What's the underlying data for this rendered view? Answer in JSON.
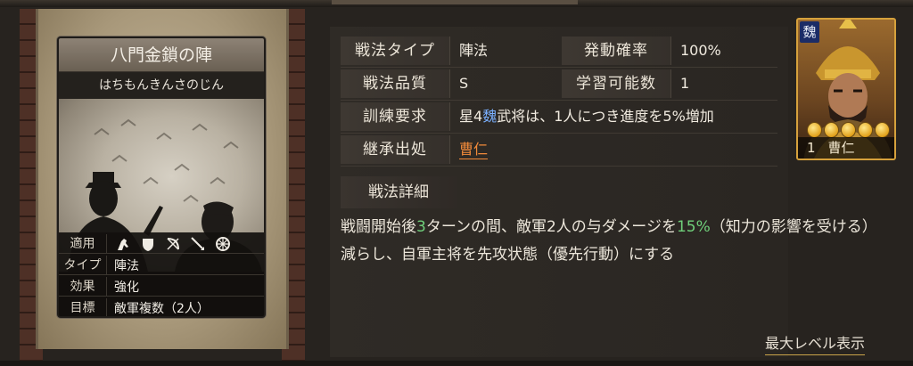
{
  "card": {
    "title": "八門金鎖の陣",
    "reading": "はちもんきんさのじん",
    "stats": [
      {
        "label": "適用",
        "value": ""
      },
      {
        "label": "タイプ",
        "value": "陣法"
      },
      {
        "label": "効果",
        "value": "強化"
      },
      {
        "label": "目標",
        "value": "敵軍複数（2人）"
      }
    ],
    "troop_icons": [
      "cavalry-icon",
      "shield-icon",
      "bow-icon",
      "spear-icon",
      "wheel-icon"
    ]
  },
  "info": {
    "type_label": "戦法タイプ",
    "type_value": "陣法",
    "activation_label": "発動確率",
    "activation_value": "100%",
    "quality_label": "戦法品質",
    "quality_value": "S",
    "learnable_label": "学習可能数",
    "learnable_value": "1",
    "training_label": "訓練要求",
    "training_pre": "星4",
    "training_kingdom": "魏",
    "training_post": "武将は、1人につき進度を5%増加",
    "origin_label": "継承出処",
    "origin_value": "曹仁"
  },
  "detail": {
    "label": "戦法詳細",
    "text_1": "戦闘開始後",
    "turns": "3",
    "text_2": "ターンの間、敵軍2人の与ダメージを",
    "percent": "15%",
    "text_3": "（知力の影響を受ける）減らし、自軍主将を先攻状態（優先行動）にする"
  },
  "max_level_button": "最大レベル表示",
  "general": {
    "kingdom": "魏",
    "cost": "1",
    "name": "曹仁",
    "stars": 5
  },
  "colors": {
    "highlight_blue": "#7ab0ff",
    "highlight_green": "#6fcf7a",
    "origin_orange": "#f18a3a",
    "gold_border": "#d6a13c"
  }
}
